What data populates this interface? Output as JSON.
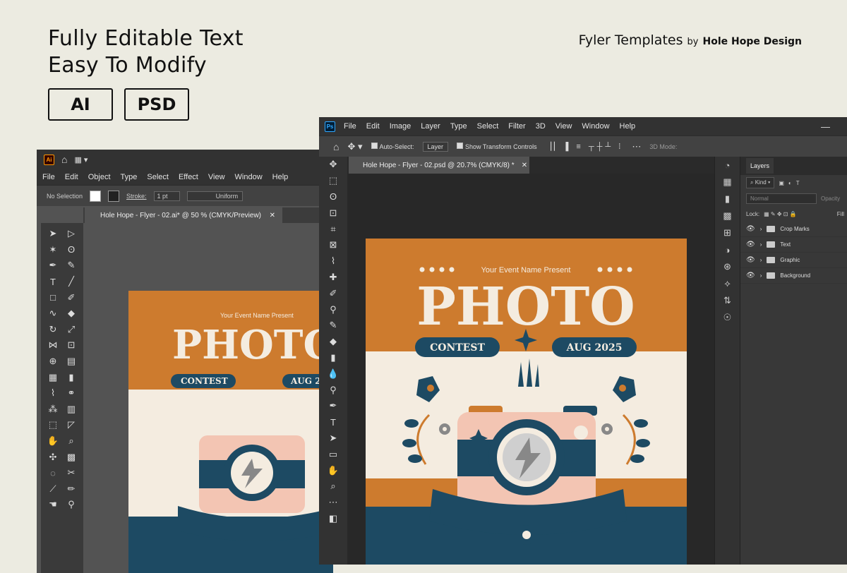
{
  "marketing": {
    "title_line1": "Fully Editable Text",
    "title_line2": "Easy To Modify",
    "badges": [
      "AI",
      "PSD"
    ],
    "brand": "Fyler Templates",
    "brand_by": "by",
    "designer": "Hole Hope Design"
  },
  "illustrator": {
    "logo": "Ai",
    "menu": [
      "File",
      "Edit",
      "Object",
      "Type",
      "Select",
      "Effect",
      "View",
      "Window",
      "Help"
    ],
    "control": {
      "selection": "No Selection",
      "stroke_label": "Stroke:",
      "stroke_value": "1 pt",
      "profile": "Uniform"
    },
    "tab_title": "Hole Hope - Flyer - 02.ai* @ 50 % (CMYK/Preview)"
  },
  "photoshop": {
    "logo": "Ps",
    "menu": [
      "File",
      "Edit",
      "Image",
      "Layer",
      "Type",
      "Select",
      "Filter",
      "3D",
      "View",
      "Window",
      "Help"
    ],
    "options": {
      "auto_select": "Auto-Select:",
      "auto_select_value": "Layer",
      "transform": "Show Transform Controls",
      "mode_3d": "3D Mode:"
    },
    "tab_title": "Hole Hope - Flyer - 02.psd @ 20.7% (CMYK/8) *",
    "layers_panel": {
      "title": "Layers",
      "filter": "Kind",
      "blend": "Normal",
      "opacity_label": "Opacity",
      "lock_label": "Lock:",
      "fill_label": "Fill",
      "layers": [
        "Crop Marks",
        "Text",
        "Graphic",
        "Background"
      ]
    }
  },
  "flyer": {
    "event_line": "Your Event Name Present",
    "headline": "PHOTO",
    "left_pill": "CONTEST",
    "right_pill": "AUG 2025",
    "ai_headline": "PHOTO",
    "ai_right_pill": "AUG 2",
    "colors": {
      "orange": "#cd7b2e",
      "navy": "#1d4a63",
      "cream": "#f4ece0",
      "pink": "#f3c5b3"
    }
  }
}
